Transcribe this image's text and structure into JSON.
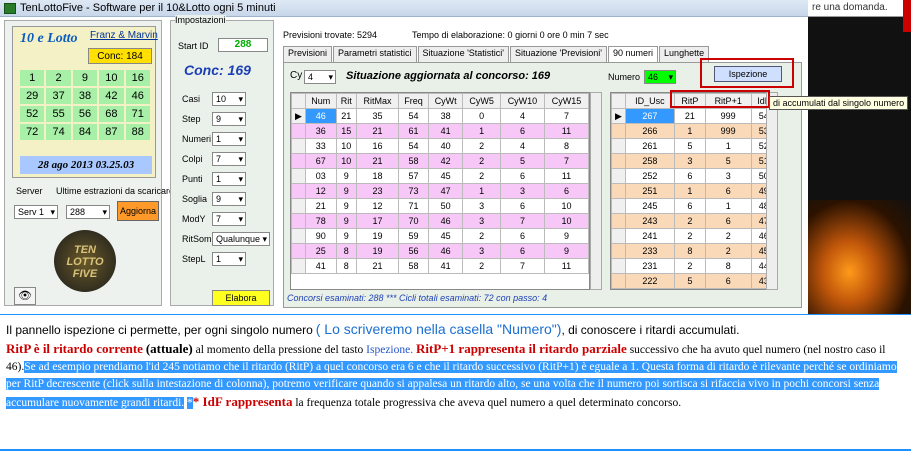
{
  "window": {
    "title": "TenLottoFive - Software per il 10&Lotto ogni 5 minuti"
  },
  "search": {
    "question": "re una domanda."
  },
  "lotto": {
    "logo": "10 e Lotto",
    "authors": "Franz & Marvin",
    "conc": "Conc: 184",
    "numbers": [
      "1",
      "2",
      "9",
      "10",
      "16",
      "29",
      "37",
      "38",
      "42",
      "46",
      "52",
      "55",
      "56",
      "68",
      "71",
      "72",
      "74",
      "84",
      "87",
      "88"
    ],
    "date": "28 ago 2013 03.25.03"
  },
  "server": {
    "server_label": "Server",
    "ultime_label": "Ultime estrazioni da scaricare",
    "serv_value": "Serv 1",
    "count_value": "288",
    "aggiorna": "Aggiorna"
  },
  "eye_icon": "eye-icon",
  "tenlotto_logo": "TEN LOTTO FIVE",
  "impostazioni": {
    "title": "Impostazioni",
    "start_label": "Start ID",
    "start_value": "288",
    "conc": "Conc: 169",
    "fields": [
      {
        "label": "Casi",
        "value": "10"
      },
      {
        "label": "Step",
        "value": "9"
      },
      {
        "label": "Numeri",
        "value": "1"
      },
      {
        "label": "Colpi",
        "value": "7"
      },
      {
        "label": "Punti",
        "value": "1"
      },
      {
        "label": "Soglia",
        "value": "9"
      },
      {
        "label": "ModY",
        "value": "7"
      },
      {
        "label": "RitSom",
        "value": "Qualunque"
      },
      {
        "label": "StepL",
        "value": "1"
      }
    ],
    "elabora": "Elabora"
  },
  "info": {
    "previsioni": "Previsioni trovate: 5294",
    "tempo": "Tempo di elaborazione: 0 giorni 0 ore 0 min 7 sec"
  },
  "tabs": [
    "Previsioni",
    "Parametri statistici",
    "Situazione 'Statistici'",
    "Situazione 'Previsioni'",
    "90 numeri",
    "Lunghette"
  ],
  "panel": {
    "cy_label": "Cy",
    "cy_value": "4",
    "situazione": "Situazione aggiornata al concorso: 169",
    "numero_label": "Numero",
    "numero_value": "46",
    "ispezione": "Ispezione",
    "tooltip": "di accumulati dal singolo numero",
    "concorsi": "Concorsi esaminati: 288 *** Cicli totali esaminati: 72 con passo: 4"
  },
  "table1": {
    "headers": [
      "Num",
      "Rit",
      "RitMax",
      "Freq",
      "CyWt",
      "CyW5",
      "CyW10",
      "CyW15"
    ],
    "rows": [
      [
        "46",
        "21",
        "35",
        "54",
        "38",
        "0",
        "4",
        "7"
      ],
      [
        "36",
        "15",
        "21",
        "61",
        "41",
        "1",
        "6",
        "11"
      ],
      [
        "33",
        "10",
        "16",
        "54",
        "40",
        "2",
        "4",
        "8"
      ],
      [
        "67",
        "10",
        "21",
        "58",
        "42",
        "2",
        "5",
        "7"
      ],
      [
        "03",
        "9",
        "18",
        "57",
        "45",
        "2",
        "6",
        "11"
      ],
      [
        "12",
        "9",
        "23",
        "73",
        "47",
        "1",
        "3",
        "6"
      ],
      [
        "21",
        "9",
        "12",
        "71",
        "50",
        "3",
        "6",
        "10"
      ],
      [
        "78",
        "9",
        "17",
        "70",
        "46",
        "3",
        "7",
        "10"
      ],
      [
        "90",
        "9",
        "19",
        "59",
        "45",
        "2",
        "6",
        "9"
      ],
      [
        "25",
        "8",
        "19",
        "56",
        "46",
        "3",
        "6",
        "9"
      ],
      [
        "41",
        "8",
        "21",
        "58",
        "41",
        "2",
        "7",
        "11"
      ]
    ]
  },
  "table2": {
    "headers": [
      "ID_Usc",
      "RitP",
      "RitP+1",
      "IdF"
    ],
    "rows": [
      [
        "267",
        "21",
        "999",
        "54"
      ],
      [
        "266",
        "1",
        "999",
        "53"
      ],
      [
        "261",
        "5",
        "1",
        "52"
      ],
      [
        "258",
        "3",
        "5",
        "51"
      ],
      [
        "252",
        "6",
        "3",
        "50"
      ],
      [
        "251",
        "1",
        "6",
        "49"
      ],
      [
        "245",
        "6",
        "1",
        "48"
      ],
      [
        "243",
        "2",
        "6",
        "47"
      ],
      [
        "241",
        "2",
        "2",
        "46"
      ],
      [
        "233",
        "8",
        "2",
        "45"
      ],
      [
        "231",
        "2",
        "8",
        "44"
      ],
      [
        "222",
        "5",
        "6",
        "43"
      ]
    ]
  },
  "text": {
    "p1a": "Il pannello ispezione ci permette, per ogni singolo numero",
    "p1b": "( Lo scriveremo nella casella \"Numero\")",
    "p1c": ", di conoscere i ritardi accumulati.",
    "ritp": "RitP è il ritardo corrente",
    "attuale": "(attuale)",
    "p2a": "al momento della pressione del tasto",
    "ispez": "Ispezione.",
    "ritp1": "RitP+1   rappresenta il ritardo parziale",
    "p2b": "successivo che ha avuto quel numero (nel nostro caso il 46).",
    "hl": "Se ad esempio prendiamo l'id 245 notiamo che il ritardo (RitP) a quel concorso era 6 e che il ritardo successivo (RitP+1) è eguale a 1. Questa forma di ritardo è rilevante perché se ordiniamo per RitP decrescente (click sulla intestazione di colonna), potremo verificare  quando si appalesa un ritardo alto, se una volta che il numero poi sortisca si rifaccia vivo in pochi concorsi senza accumulare nuovamente grandi ritardi.",
    "star": "*",
    "idf": "* IdF rappresenta",
    "p3": "la frequenza totale progressiva che aveva quel numero a quel determinato concorso."
  },
  "colors": {
    "highlight": "#3399ff",
    "red": "#cc0000",
    "pink": "#f7c8f7",
    "peach": "#f9d9b8"
  }
}
